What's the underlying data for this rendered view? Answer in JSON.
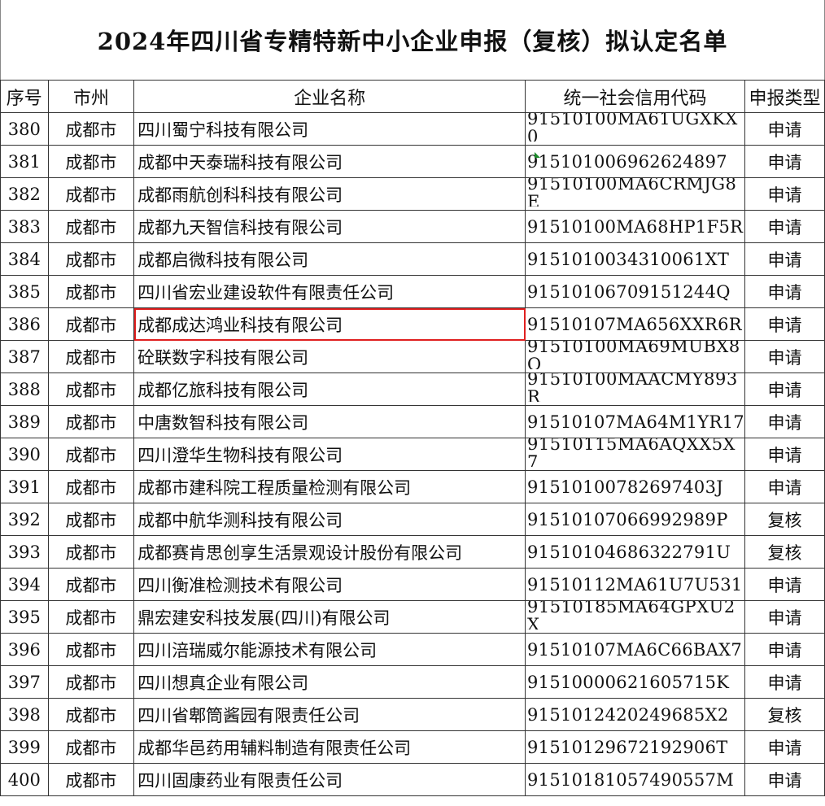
{
  "title": "2024年四川省专精特新中小企业申报（复核）拟认定名单",
  "headers": [
    "序号",
    "市州",
    "企业名称",
    "统一社会信用代码",
    "申报类型"
  ],
  "rows": [
    {
      "no": "380",
      "city": "成都市",
      "name": "四川蜀宁科技有限公司",
      "code": "91510100MA61UGXKX0",
      "type": "申请",
      "wrap": true
    },
    {
      "no": "381",
      "city": "成都市",
      "name": "成都中天泰瑞科技有限公司",
      "code": "91510100696262489​7",
      "type": "申请",
      "wrap": false
    },
    {
      "no": "382",
      "city": "成都市",
      "name": "成都雨航创科科技有限公司",
      "code": "91510100MA6CRMJG8E",
      "type": "申请",
      "wrap": true
    },
    {
      "no": "383",
      "city": "成都市",
      "name": "成都九天智信科技有限公司",
      "code": "91510100MA68HP1F5R",
      "type": "申请",
      "wrap": false
    },
    {
      "no": "384",
      "city": "成都市",
      "name": "成都启微科技有限公司",
      "code": "9151010034310061XT",
      "type": "申请",
      "wrap": false
    },
    {
      "no": "385",
      "city": "成都市",
      "name": "四川省宏业建设软件有限责任公司",
      "code": "91510106709151244Q",
      "type": "申请",
      "wrap": false
    },
    {
      "no": "386",
      "city": "成都市",
      "name": "成都成达鸿业科技有限公司",
      "code": "91510107MA656XXR6R",
      "type": "申请",
      "wrap": false,
      "highlight": true
    },
    {
      "no": "387",
      "city": "成都市",
      "name": "砼联数字科技有限公司",
      "code": "91510100MA69MUBX8Q",
      "type": "申请",
      "wrap": true
    },
    {
      "no": "388",
      "city": "成都市",
      "name": "成都亿旅科技有限公司",
      "code": "91510100MAACMY893R",
      "type": "申请",
      "wrap": true
    },
    {
      "no": "389",
      "city": "成都市",
      "name": "中唐数智科技有限公司",
      "code": "91510107MA64M1YR17",
      "type": "申请",
      "wrap": false
    },
    {
      "no": "390",
      "city": "成都市",
      "name": "四川澄华生物科技有限公司",
      "code": "91510115MA6AQXX5X7",
      "type": "申请",
      "wrap": true
    },
    {
      "no": "391",
      "city": "成都市",
      "name": "成都市建科院工程质量检测有限公司",
      "code": "91510100782697403J",
      "type": "申请",
      "wrap": false
    },
    {
      "no": "392",
      "city": "成都市",
      "name": "成都中航华测科技有限公司",
      "code": "91510107066992989P",
      "type": "复核",
      "wrap": false
    },
    {
      "no": "393",
      "city": "成都市",
      "name": "成都赛肯思创享生活景观设计股份有限公司",
      "code": "91510104686322791U",
      "type": "复核",
      "wrap": false
    },
    {
      "no": "394",
      "city": "成都市",
      "name": "四川衡准检测技术有限公司",
      "code": "91510112MA61U7U531",
      "type": "申请",
      "wrap": false
    },
    {
      "no": "395",
      "city": "成都市",
      "name": "鼎宏建安科技发展(四川)有限公司",
      "code": "91510185MA64GPXU2X",
      "type": "申请",
      "wrap": true
    },
    {
      "no": "396",
      "city": "成都市",
      "name": "四川涪瑞威尔能源技术有限公司",
      "code": "91510107MA6C66BAX7",
      "type": "申请",
      "wrap": false
    },
    {
      "no": "397",
      "city": "成都市",
      "name": "四川想真企业有限公司",
      "code": "91510000621605715K",
      "type": "申请",
      "wrap": false
    },
    {
      "no": "398",
      "city": "成都市",
      "name": "四川省郫筒酱园有限责任公司",
      "code": "9151012420249685X2",
      "type": "复核",
      "wrap": false
    },
    {
      "no": "399",
      "city": "成都市",
      "name": "成都华邑药用辅料制造有限责任公司",
      "code": "91510129672192906T",
      "type": "申请",
      "wrap": false
    },
    {
      "no": "400",
      "city": "成都市",
      "name": "四川固康药业有限责任公司",
      "code": "91510181057490557M",
      "type": "申请",
      "wrap": false
    }
  ]
}
